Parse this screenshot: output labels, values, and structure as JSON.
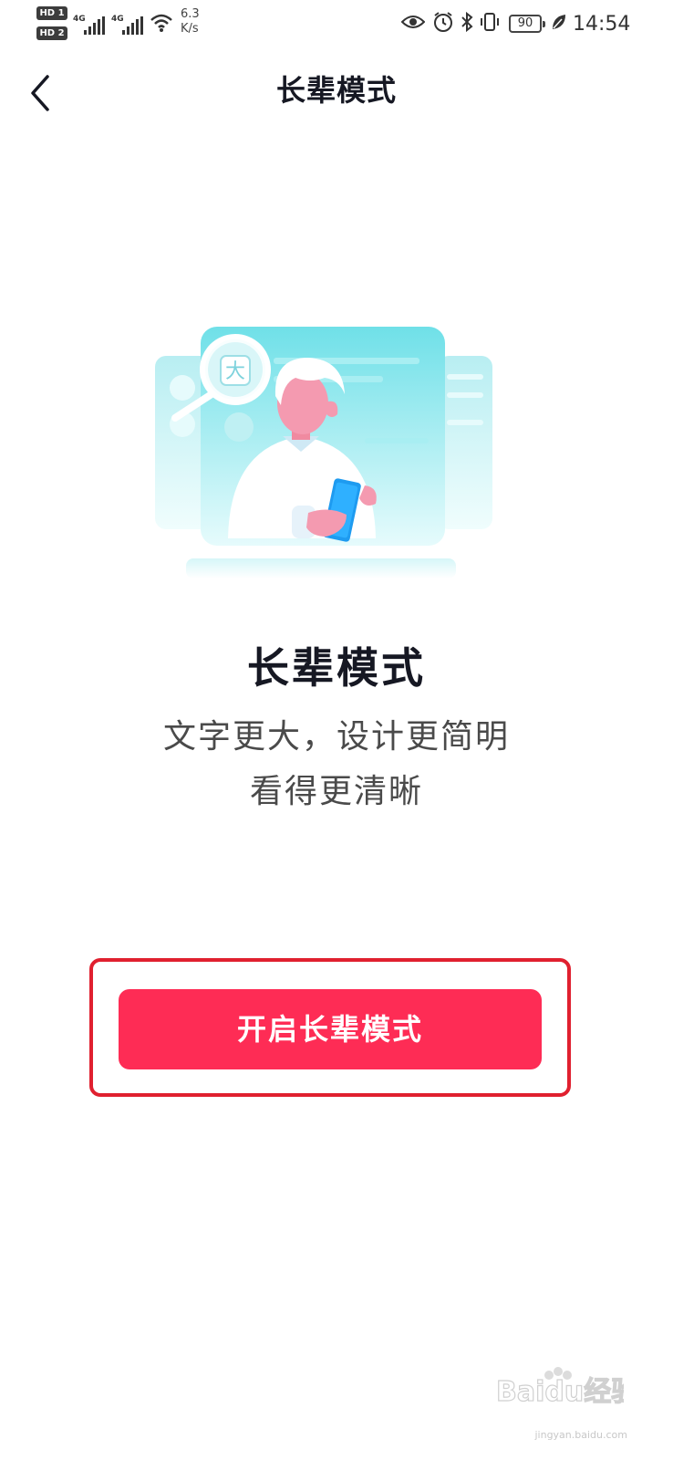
{
  "status_bar": {
    "sim1_badge": "HD 1",
    "sim2_badge": "HD 2",
    "network1": "4G",
    "network2": "4G",
    "net_speed_value": "6.3",
    "net_speed_unit": "K/s",
    "battery": "90",
    "time": "14:54"
  },
  "nav": {
    "title": "长辈模式"
  },
  "content": {
    "headline": "长辈模式",
    "desc_line1": "文字更大，设计更简明",
    "desc_line2": "看得更清晰",
    "illustration_magnifier_char": "大"
  },
  "actions": {
    "enable_button": "开启长辈模式"
  },
  "watermark": {
    "brand": "Baidu经验",
    "url": "jingyan.baidu.com"
  },
  "colors": {
    "primary": "#fe2c55",
    "highlight": "#e0202f",
    "title_text": "#161823"
  }
}
